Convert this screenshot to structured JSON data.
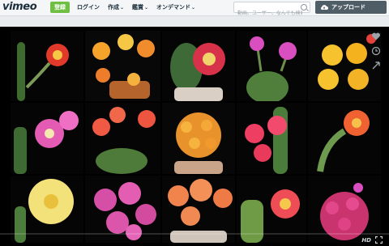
{
  "header": {
    "logo": "vimeo",
    "join_label": "登録",
    "nav": [
      {
        "label": "ログイン"
      },
      {
        "label": "作成"
      },
      {
        "label": "鑑賞"
      },
      {
        "label": "オンデマンド"
      }
    ],
    "search_placeholder": "動画、ユーザー、なんでも検索",
    "upload_label": "アップロード"
  },
  "player": {
    "progress": 0.0,
    "hd_label": "HD",
    "side_icons": [
      "heart-icon",
      "clock-icon",
      "share-icon"
    ]
  },
  "colors": {
    "accent_green": "#6fc042",
    "upload_bg": "#4f5d66",
    "progress_blue": "#00adef"
  }
}
